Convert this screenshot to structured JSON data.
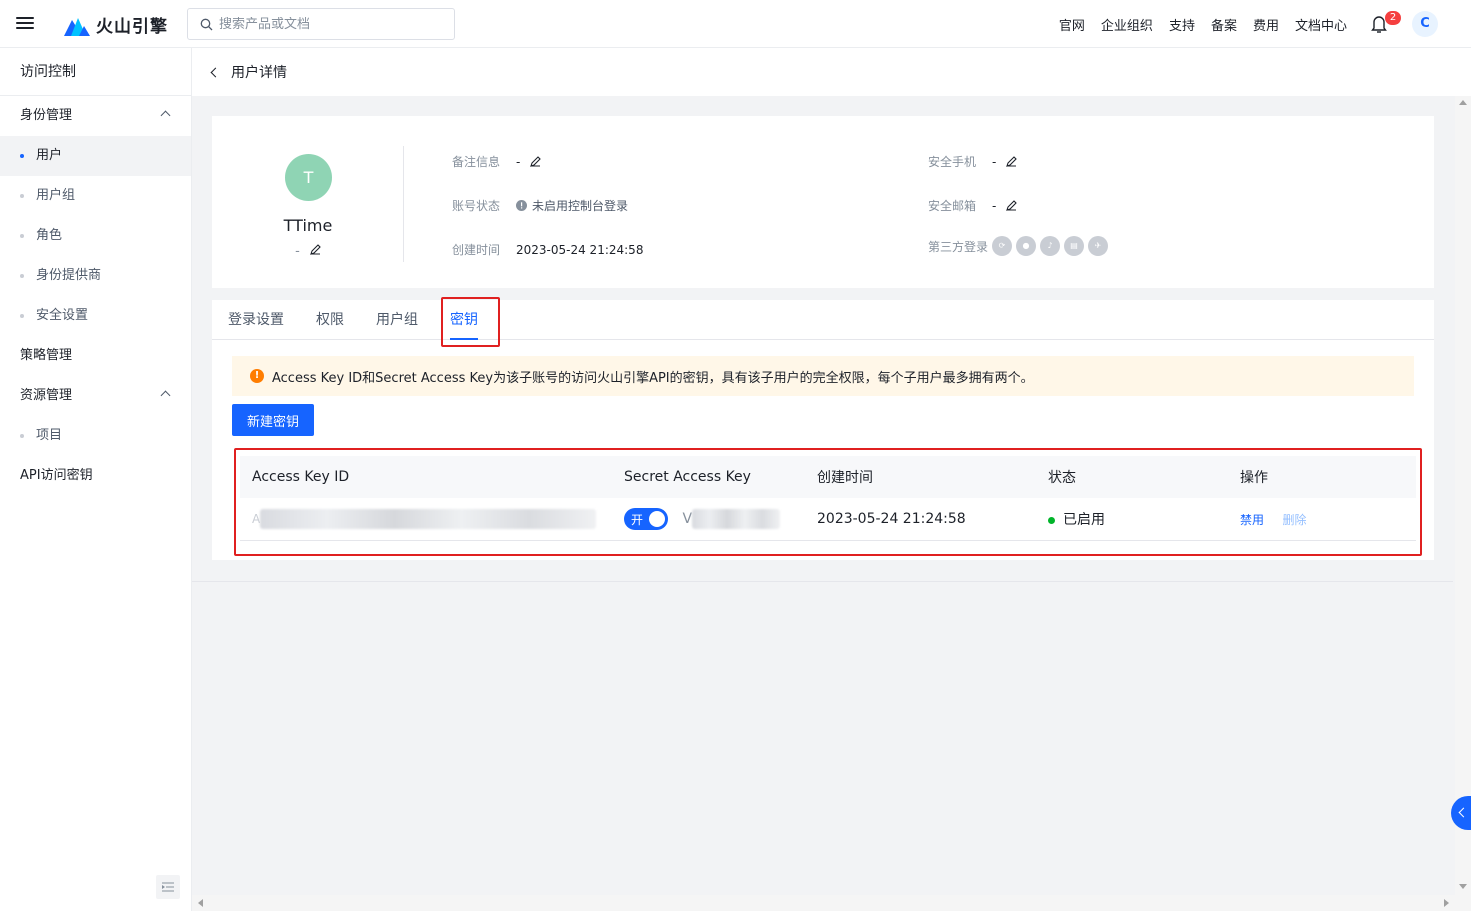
{
  "topbar": {
    "brand": "火山引擎",
    "search_placeholder": "搜索产品或文档",
    "nav": [
      "官网",
      "企业组织",
      "支持",
      "备案",
      "费用",
      "文档中心"
    ],
    "notification_count": "2",
    "avatar_letter": "C"
  },
  "sidebar": {
    "title": "访问控制",
    "identity_group": "身份管理",
    "identity_items": [
      "用户",
      "用户组",
      "角色",
      "身份提供商",
      "安全设置"
    ],
    "policy": "策略管理",
    "resource_group": "资源管理",
    "resource_items": [
      "项目"
    ],
    "api_keys": "API访问密钥"
  },
  "breadcrumb": {
    "title": "用户详情"
  },
  "user": {
    "avatar_letter": "T",
    "name": "TTime",
    "remark": "-",
    "fields": {
      "remark_label": "备注信息",
      "remark_value": "-",
      "status_label": "账号状态",
      "status_value": "未启用控制台登录",
      "created_label": "创建时间",
      "created_value": "2023-05-24 21:24:58",
      "phone_label": "安全手机",
      "phone_value": "-",
      "email_label": "安全邮箱",
      "email_value": "-",
      "thirdparty_label": "第三方登录"
    }
  },
  "tabs": [
    "登录设置",
    "权限",
    "用户组",
    "密钥"
  ],
  "active_tab": "密钥",
  "notice": "Access Key ID和Secret Access Key为该子账号的访问火山引擎API的密钥，具有该子用户的完全权限，每个子用户最多拥有两个。",
  "new_key_button": "新建密钥",
  "table": {
    "headers": [
      "Access Key ID",
      "Secret Access Key",
      "创建时间",
      "状态",
      "操作"
    ],
    "rows": [
      {
        "access_key_prefix": "A",
        "toggle_label": "开",
        "secret_prefix": "V",
        "created": "2023-05-24 21:24:58",
        "status": "已启用",
        "action_disable": "禁用",
        "action_delete": "删除"
      }
    ]
  },
  "colors": {
    "primary": "#1664ff",
    "success": "#00b42a",
    "warning": "#ff7d00",
    "highlight": "#e02020"
  }
}
